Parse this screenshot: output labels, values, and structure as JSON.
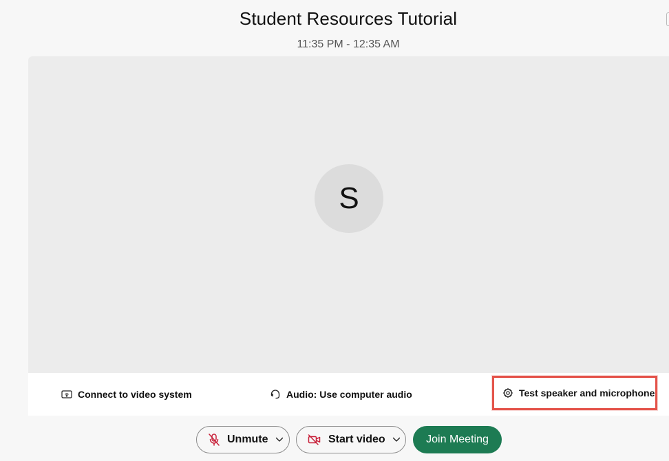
{
  "meeting": {
    "title": "Student Resources Tutorial",
    "time": "11:35 PM - 12:35 AM",
    "avatar_initial": "S"
  },
  "options": {
    "video_system_label": "Connect to video system",
    "audio_label": "Audio: Use computer audio",
    "test_label": "Test speaker and microphone"
  },
  "controls": {
    "unmute_label": "Unmute",
    "start_video_label": "Start video",
    "join_label": "Join Meeting"
  },
  "colors": {
    "join_button": "#1d7b53",
    "highlight_box": "#e4544b",
    "muted_icon": "#c8213a"
  },
  "icons": {
    "video_system": "screen-cast-icon",
    "audio": "headset-icon",
    "test": "gear-icon",
    "unmute": "microphone-muted-icon",
    "start_video": "camera-off-icon",
    "dropdown": "chevron-down-icon"
  }
}
